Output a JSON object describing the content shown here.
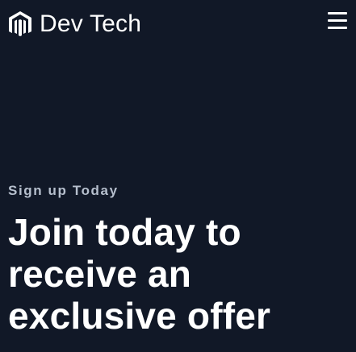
{
  "header": {
    "brand_name": "Dev Tech",
    "brand_logo_icon": "magento-style-logo-icon",
    "menu_icon": "hamburger-menu-icon"
  },
  "hero": {
    "eyebrow": "Sign up Today",
    "headline": "Join today to receive an exclusive offer"
  },
  "colors": {
    "background": "#111827",
    "text": "#ffffff",
    "eyebrow": "#b6bfcd"
  }
}
